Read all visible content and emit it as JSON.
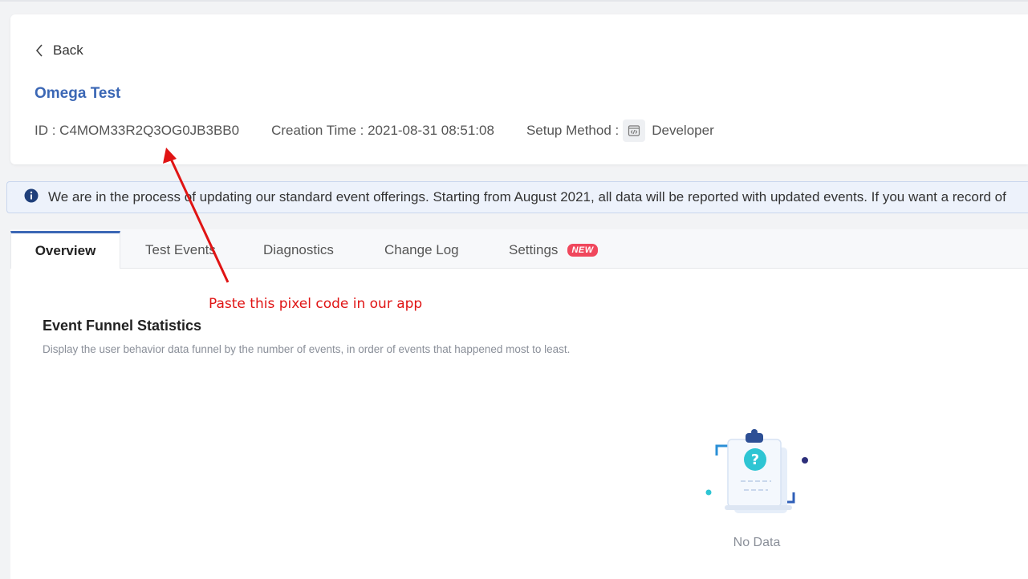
{
  "header": {
    "back_label": "Back",
    "title": "Omega Test",
    "id_text": "ID : C4MOM33R2Q3OG0JB3BB0",
    "creation_text": "Creation Time : 2021-08-31 08:51:08",
    "setup_label": "Setup Method :",
    "setup_value": "Developer"
  },
  "banner": {
    "text": "We are in the process of updating our standard event offerings. Starting from August 2021, all data will be reported with updated events. If you want a record of"
  },
  "tabs": [
    {
      "label": "Overview",
      "active": true
    },
    {
      "label": "Test Events"
    },
    {
      "label": "Diagnostics"
    },
    {
      "label": "Change Log"
    },
    {
      "label": "Settings",
      "badge": "NEW"
    }
  ],
  "annotation": {
    "text": "Paste this pixel code in our app",
    "color": "#e01414"
  },
  "section": {
    "title": "Event Funnel Statistics",
    "description": "Display the user behavior data funnel by the number of events, in order of events that happened most to least."
  },
  "empty_state": {
    "text": "No Data",
    "icon": "clipboard-question-icon"
  },
  "colors": {
    "accent": "#3b67b5",
    "badge": "#f0475c",
    "banner_bg": "#edf2fb"
  }
}
